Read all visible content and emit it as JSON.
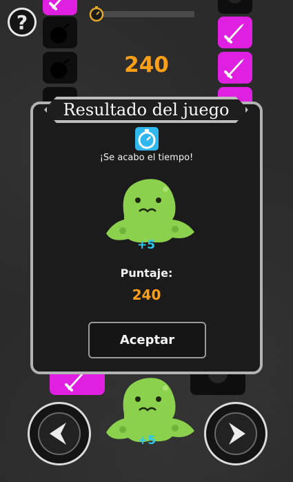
{
  "hud": {
    "help_label": "?",
    "score": "240",
    "timer_progress": 0
  },
  "dialog": {
    "title": "Resultado del juego",
    "message": "¡Se acabo el tiempo!",
    "bonus": "+5",
    "score_label": "Puntaje:",
    "score_value": "240",
    "accept_label": "Aceptar"
  },
  "board": {
    "bottom_bonus": "+5"
  },
  "colors": {
    "accent_orange": "#ff9f16",
    "tile_pink": "#e020e0",
    "bonus_cyan": "#2cc8ee",
    "slime_green": "#8bd14e"
  },
  "icons": [
    "help-icon",
    "timer-icon",
    "bomb-icon",
    "sword-icon",
    "clock-icon",
    "slime-icon",
    "arrow-left-icon",
    "arrow-right-icon"
  ]
}
